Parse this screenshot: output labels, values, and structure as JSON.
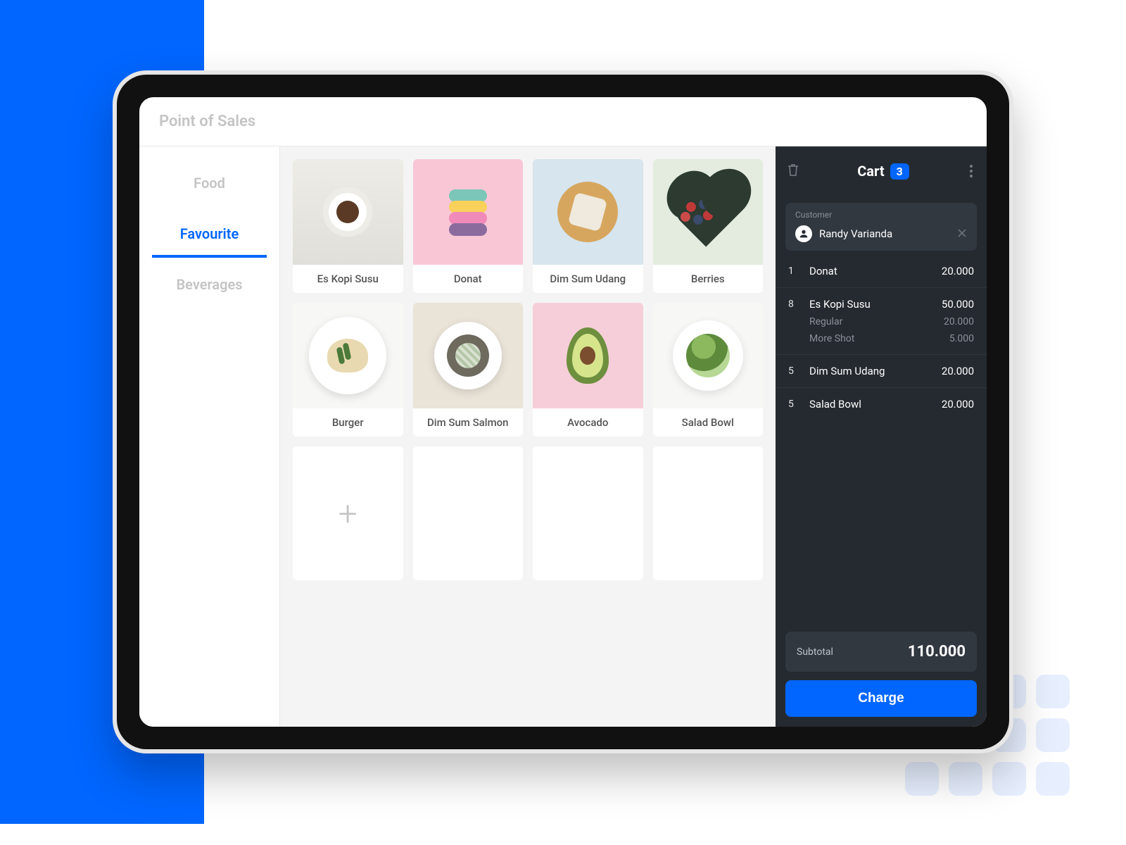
{
  "app_title": "Point of Sales",
  "categories": [
    {
      "label": "Food",
      "active": false
    },
    {
      "label": "Favourite",
      "active": true
    },
    {
      "label": "Beverages",
      "active": false
    }
  ],
  "products": [
    {
      "name": "Es Kopi Susu",
      "bg": "bg-latte",
      "icon": "coffee-cup"
    },
    {
      "name": "Donat",
      "bg": "bg-pink",
      "icon": "macaron-stack"
    },
    {
      "name": "Dim Sum Udang",
      "bg": "bg-blue",
      "icon": "dimsum-plate"
    },
    {
      "name": "Berries",
      "bg": "bg-mint",
      "icon": "heart"
    },
    {
      "name": "Burger",
      "bg": "bg-white",
      "icon": "burger-plate"
    },
    {
      "name": "Dim Sum Salmon",
      "bg": "bg-cream",
      "icon": "bowl-plate"
    },
    {
      "name": "Avocado",
      "bg": "bg-pink2",
      "icon": "avocado-half"
    },
    {
      "name": "Salad Bowl",
      "bg": "bg-white",
      "icon": "salad-plate"
    }
  ],
  "cart": {
    "title": "Cart",
    "badge": "3",
    "customer_label": "Customer",
    "customer_name": "Randy Varianda",
    "items": [
      {
        "qty": "1",
        "name": "Donat",
        "price": "20.000",
        "subs": []
      },
      {
        "qty": "8",
        "name": "Es Kopi Susu",
        "price": "50.000",
        "subs": [
          {
            "name": "Regular",
            "price": "20.000"
          },
          {
            "name": "More Shot",
            "price": "5.000"
          }
        ]
      },
      {
        "qty": "5",
        "name": "Dim Sum Udang",
        "price": "20.000",
        "subs": []
      },
      {
        "qty": "5",
        "name": "Salad Bowl",
        "price": "20.000",
        "subs": []
      }
    ],
    "subtotal_label": "Subtotal",
    "subtotal_value": "110.000",
    "charge_label": "Charge"
  },
  "colors": {
    "accent": "#0066FF",
    "dark": "#252A30"
  }
}
